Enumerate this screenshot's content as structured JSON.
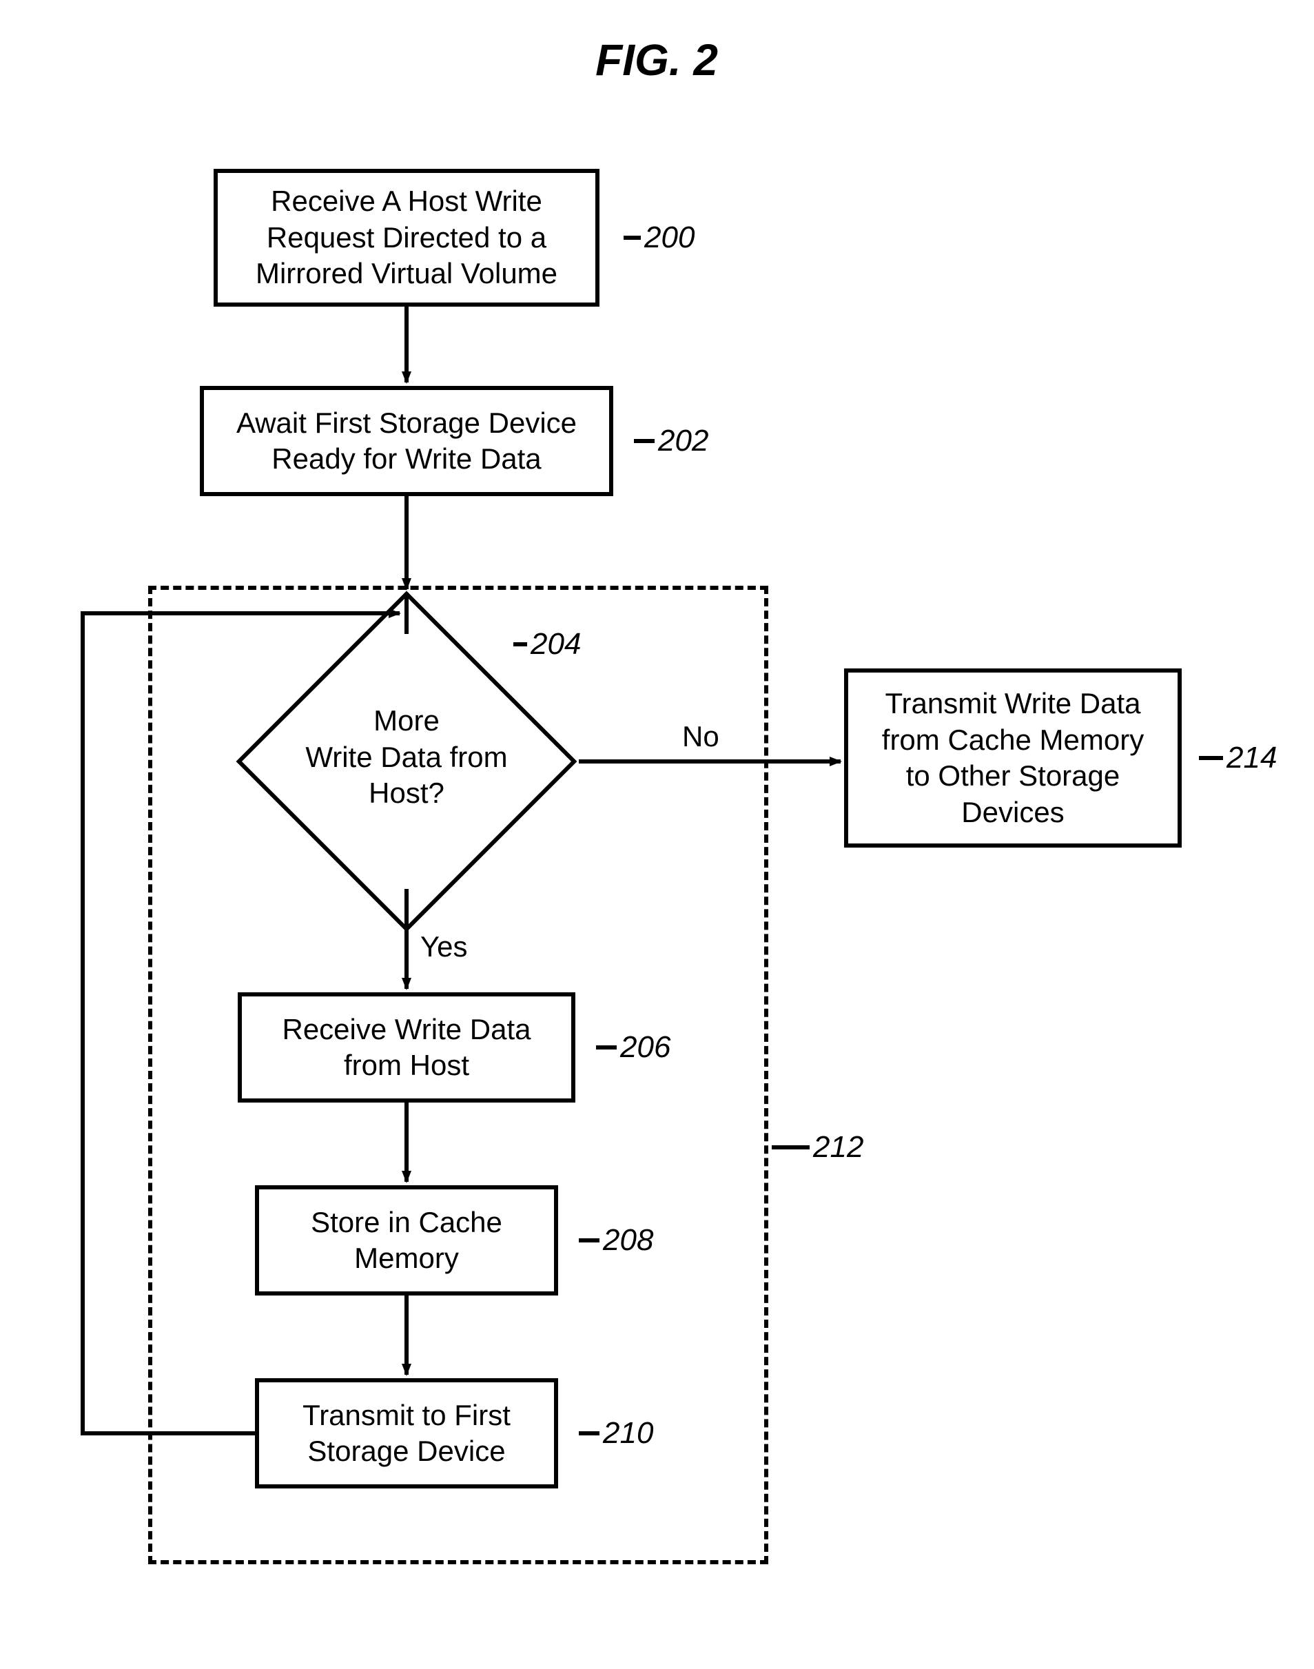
{
  "title": "FIG. 2",
  "nodes": {
    "n200": {
      "text": "Receive A Host Write\nRequest Directed to a\nMirrored Virtual Volume",
      "ref": "200"
    },
    "n202": {
      "text": "Await First Storage Device\nReady for Write Data",
      "ref": "202"
    },
    "n204": {
      "text": "More\nWrite Data from\nHost?",
      "ref": "204"
    },
    "n206": {
      "text": "Receive Write Data\nfrom Host",
      "ref": "206"
    },
    "n208": {
      "text": "Store in Cache\nMemory",
      "ref": "208"
    },
    "n210": {
      "text": "Transmit to First\nStorage Device",
      "ref": "210"
    },
    "n214": {
      "text": "Transmit Write Data\nfrom Cache Memory\nto Other Storage\nDevices",
      "ref": "214"
    }
  },
  "loop_ref": "212",
  "labels": {
    "yes": "Yes",
    "no": "No"
  }
}
